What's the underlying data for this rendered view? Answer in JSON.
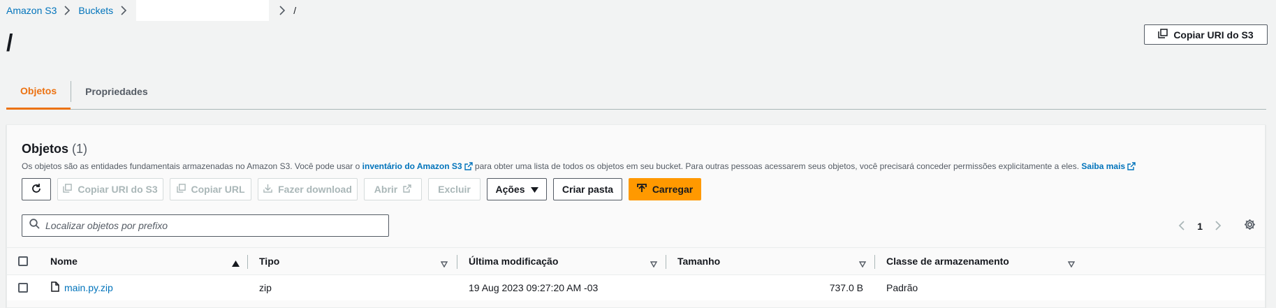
{
  "breadcrumb": {
    "items": [
      "Amazon S3",
      "Buckets"
    ],
    "current": "/"
  },
  "page": {
    "title": "/",
    "copy_uri_label": "Copiar URI do S3"
  },
  "tabs": [
    {
      "label": "Objetos",
      "active": true
    },
    {
      "label": "Propriedades",
      "active": false
    }
  ],
  "objects": {
    "title": "Objetos",
    "count": "(1)",
    "desc_prefix": "Os objetos são as entidades fundamentais armazenadas no Amazon S3. Você pode usar o",
    "desc_link1": "inventário do Amazon S3",
    "desc_middle": "para obter uma lista de todos os objetos em seu bucket. Para outras pessoas acessarem seus objetos, você precisará conceder permissões explicitamente a eles.",
    "desc_link2": "Saiba mais"
  },
  "toolbar": {
    "copy_uri": "Copiar URI do S3",
    "copy_url": "Copiar URL",
    "download": "Fazer download",
    "open": "Abrir",
    "delete": "Excluir",
    "actions": "Ações",
    "create_folder": "Criar pasta",
    "upload": "Carregar"
  },
  "search": {
    "placeholder": "Localizar objetos por prefixo"
  },
  "pagination": {
    "page": "1"
  },
  "table": {
    "headers": {
      "name": "Nome",
      "type": "Tipo",
      "modified": "Última modificação",
      "size": "Tamanho",
      "storage_class": "Classe de armazenamento"
    },
    "rows": [
      {
        "name": "main.py.zip",
        "type": "zip",
        "modified": "19 Aug 2023 09:27:20 AM -03",
        "size": "737.0 B",
        "storage_class": "Padrão"
      }
    ]
  },
  "colors": {
    "link": "#0073bb",
    "accent_orange": "#ff9900",
    "tab_active": "#ec7211",
    "text": "#16191f"
  }
}
